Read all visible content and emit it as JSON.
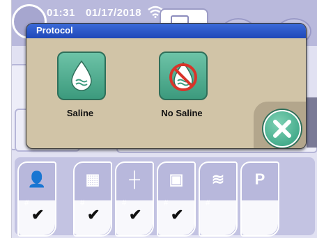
{
  "status": {
    "time": "01:31",
    "date": "01/17/2018"
  },
  "dialog": {
    "title": "Protocol",
    "options": [
      {
        "label": "Saline",
        "icon": "saline-drop-icon"
      },
      {
        "label": "No Saline",
        "icon": "no-saline-icon"
      }
    ],
    "close_icon": "close-icon"
  },
  "pumps": [
    {
      "icon": "clinician-icon",
      "mark": "#",
      "checked": "✔"
    },
    {
      "icon": "syringe-tray-icon",
      "mark": "#",
      "checked": "✔"
    },
    {
      "icon": "infusion-line-icon",
      "mark": "#",
      "checked": "✔"
    },
    {
      "icon": "control-panel-icon",
      "mark": "#",
      "checked": "✔"
    },
    {
      "icon": "fluid-bag-icon",
      "mark": "#",
      "checked": ""
    },
    {
      "icon": "pump-p-icon",
      "mark": "",
      "checked": ""
    }
  ],
  "colors": {
    "title_bar": "#2854c4",
    "dialog_bg": "#d1c4a7",
    "button_green": "#4aa98a",
    "background": "#e1e1f2"
  }
}
